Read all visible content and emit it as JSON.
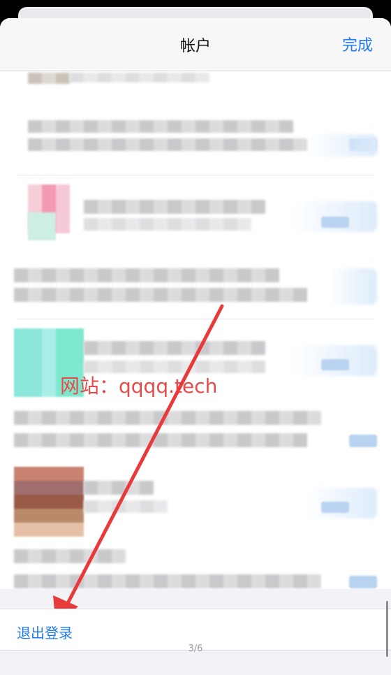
{
  "nav": {
    "title": "帐户",
    "done_label": "完成"
  },
  "watermark": "网站：qqqq.tech",
  "logout_label": "退出登录",
  "page_indicator": "3/6",
  "accounts": [
    {
      "name": "account-1",
      "status": "blurred"
    },
    {
      "name": "account-2",
      "status": "blurred"
    },
    {
      "name": "account-3",
      "status": "blurred"
    },
    {
      "name": "account-4",
      "status": "blurred"
    },
    {
      "name": "account-5",
      "status": "blurred"
    }
  ],
  "colors": {
    "accent": "#1e7cf2",
    "annotation": "#e84a4a"
  }
}
